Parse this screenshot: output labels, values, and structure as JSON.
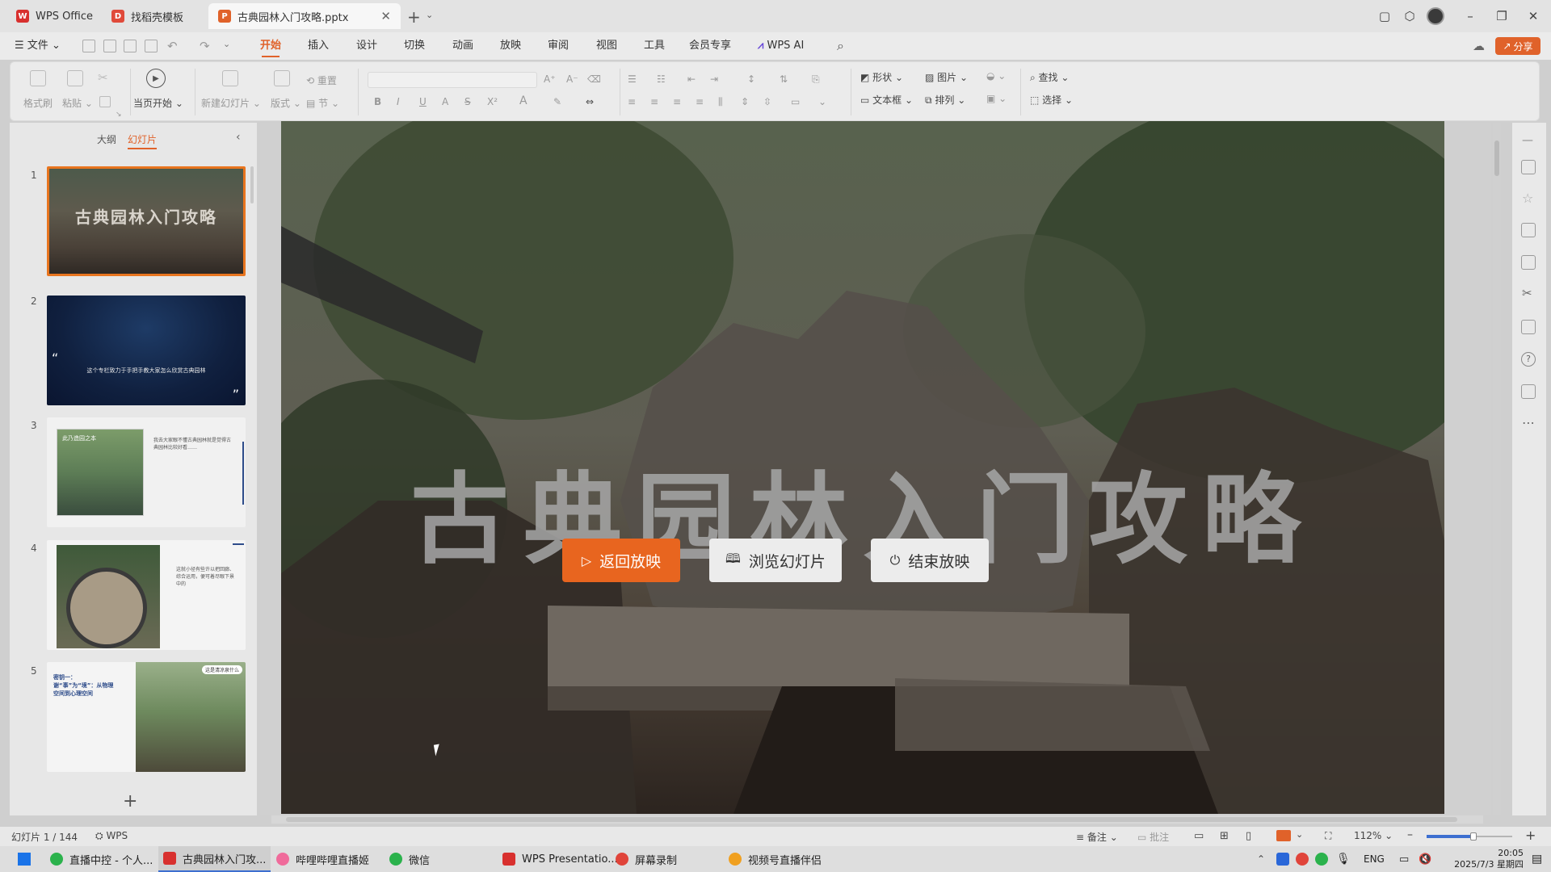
{
  "titlebar": {
    "tabs": [
      {
        "label": "WPS Office",
        "icon": "wps-logo-icon",
        "active": false
      },
      {
        "label": "找稻壳模板",
        "icon": "docer-icon",
        "active": false
      },
      {
        "label": "古典园林入门攻略.pptx",
        "icon": "pptx-file-icon",
        "active": true
      }
    ]
  },
  "menubar": {
    "file": "文件",
    "tabs": [
      "开始",
      "插入",
      "设计",
      "切换",
      "动画",
      "放映",
      "审阅",
      "视图",
      "工具",
      "会员专享",
      "WPS AI"
    ],
    "active_tab": "开始",
    "share": "分享"
  },
  "ribbon": {
    "format_painter": "格式刷",
    "paste": "粘贴",
    "from_current": "当页开始",
    "new_slide": "新建幻灯片",
    "layout": "版式",
    "reset": "重置",
    "section": "节",
    "shape": "形状",
    "picture": "图片",
    "textbox": "文本框",
    "arrange": "排列",
    "find": "查找",
    "select": "选择"
  },
  "slide_panel": {
    "tab_outline": "大纲",
    "tab_slides": "幻灯片",
    "active_tab": "幻灯片",
    "thumbs": [
      {
        "num": "1",
        "text": "古典园林入门攻略"
      },
      {
        "num": "2",
        "text": "这个专栏致力于手把手教大家怎么欣赏古典园林"
      },
      {
        "num": "3",
        "text_a": "此乃造园之本",
        "text_b": "我去大家眼不懂古典园林就是觉得古典园林比较好看……"
      },
      {
        "num": "4",
        "text": "这就小径有些许以把回廊、综合运用，便可着尽眼下景中的"
      },
      {
        "num": "5",
        "text_a": "密钥一：谢“事”为“境”：从物理空间到心理空间",
        "text_b": "这是清凉泉什么"
      }
    ],
    "add": "+"
  },
  "slide": {
    "title": "古典园林入门攻略",
    "buttons": {
      "resume": "返回放映",
      "browse": "浏览幻灯片",
      "end": "结束放映"
    },
    "colors": {
      "accent": "#e8651f"
    }
  },
  "statusbar": {
    "slide_count": "幻灯片 1 / 144",
    "wps_label": "WPS",
    "notes": "备注",
    "comment": "批注",
    "zoom": "112%"
  },
  "taskbar": {
    "items": [
      {
        "label": "直播中控 - 个人...",
        "active": false
      },
      {
        "label": "古典园林入门攻...",
        "active": true
      },
      {
        "label": "哔哩哔哩直播姬",
        "active": false
      },
      {
        "label": "微信",
        "active": false
      },
      {
        "label": "WPS Presentatio...",
        "active": false
      },
      {
        "label": "屏幕录制",
        "active": false
      },
      {
        "label": "视频号直播伴侣",
        "active": false
      }
    ],
    "tray": {
      "lang": "ENG",
      "time": "20:05",
      "date": "2025/7/3 星期四"
    }
  }
}
